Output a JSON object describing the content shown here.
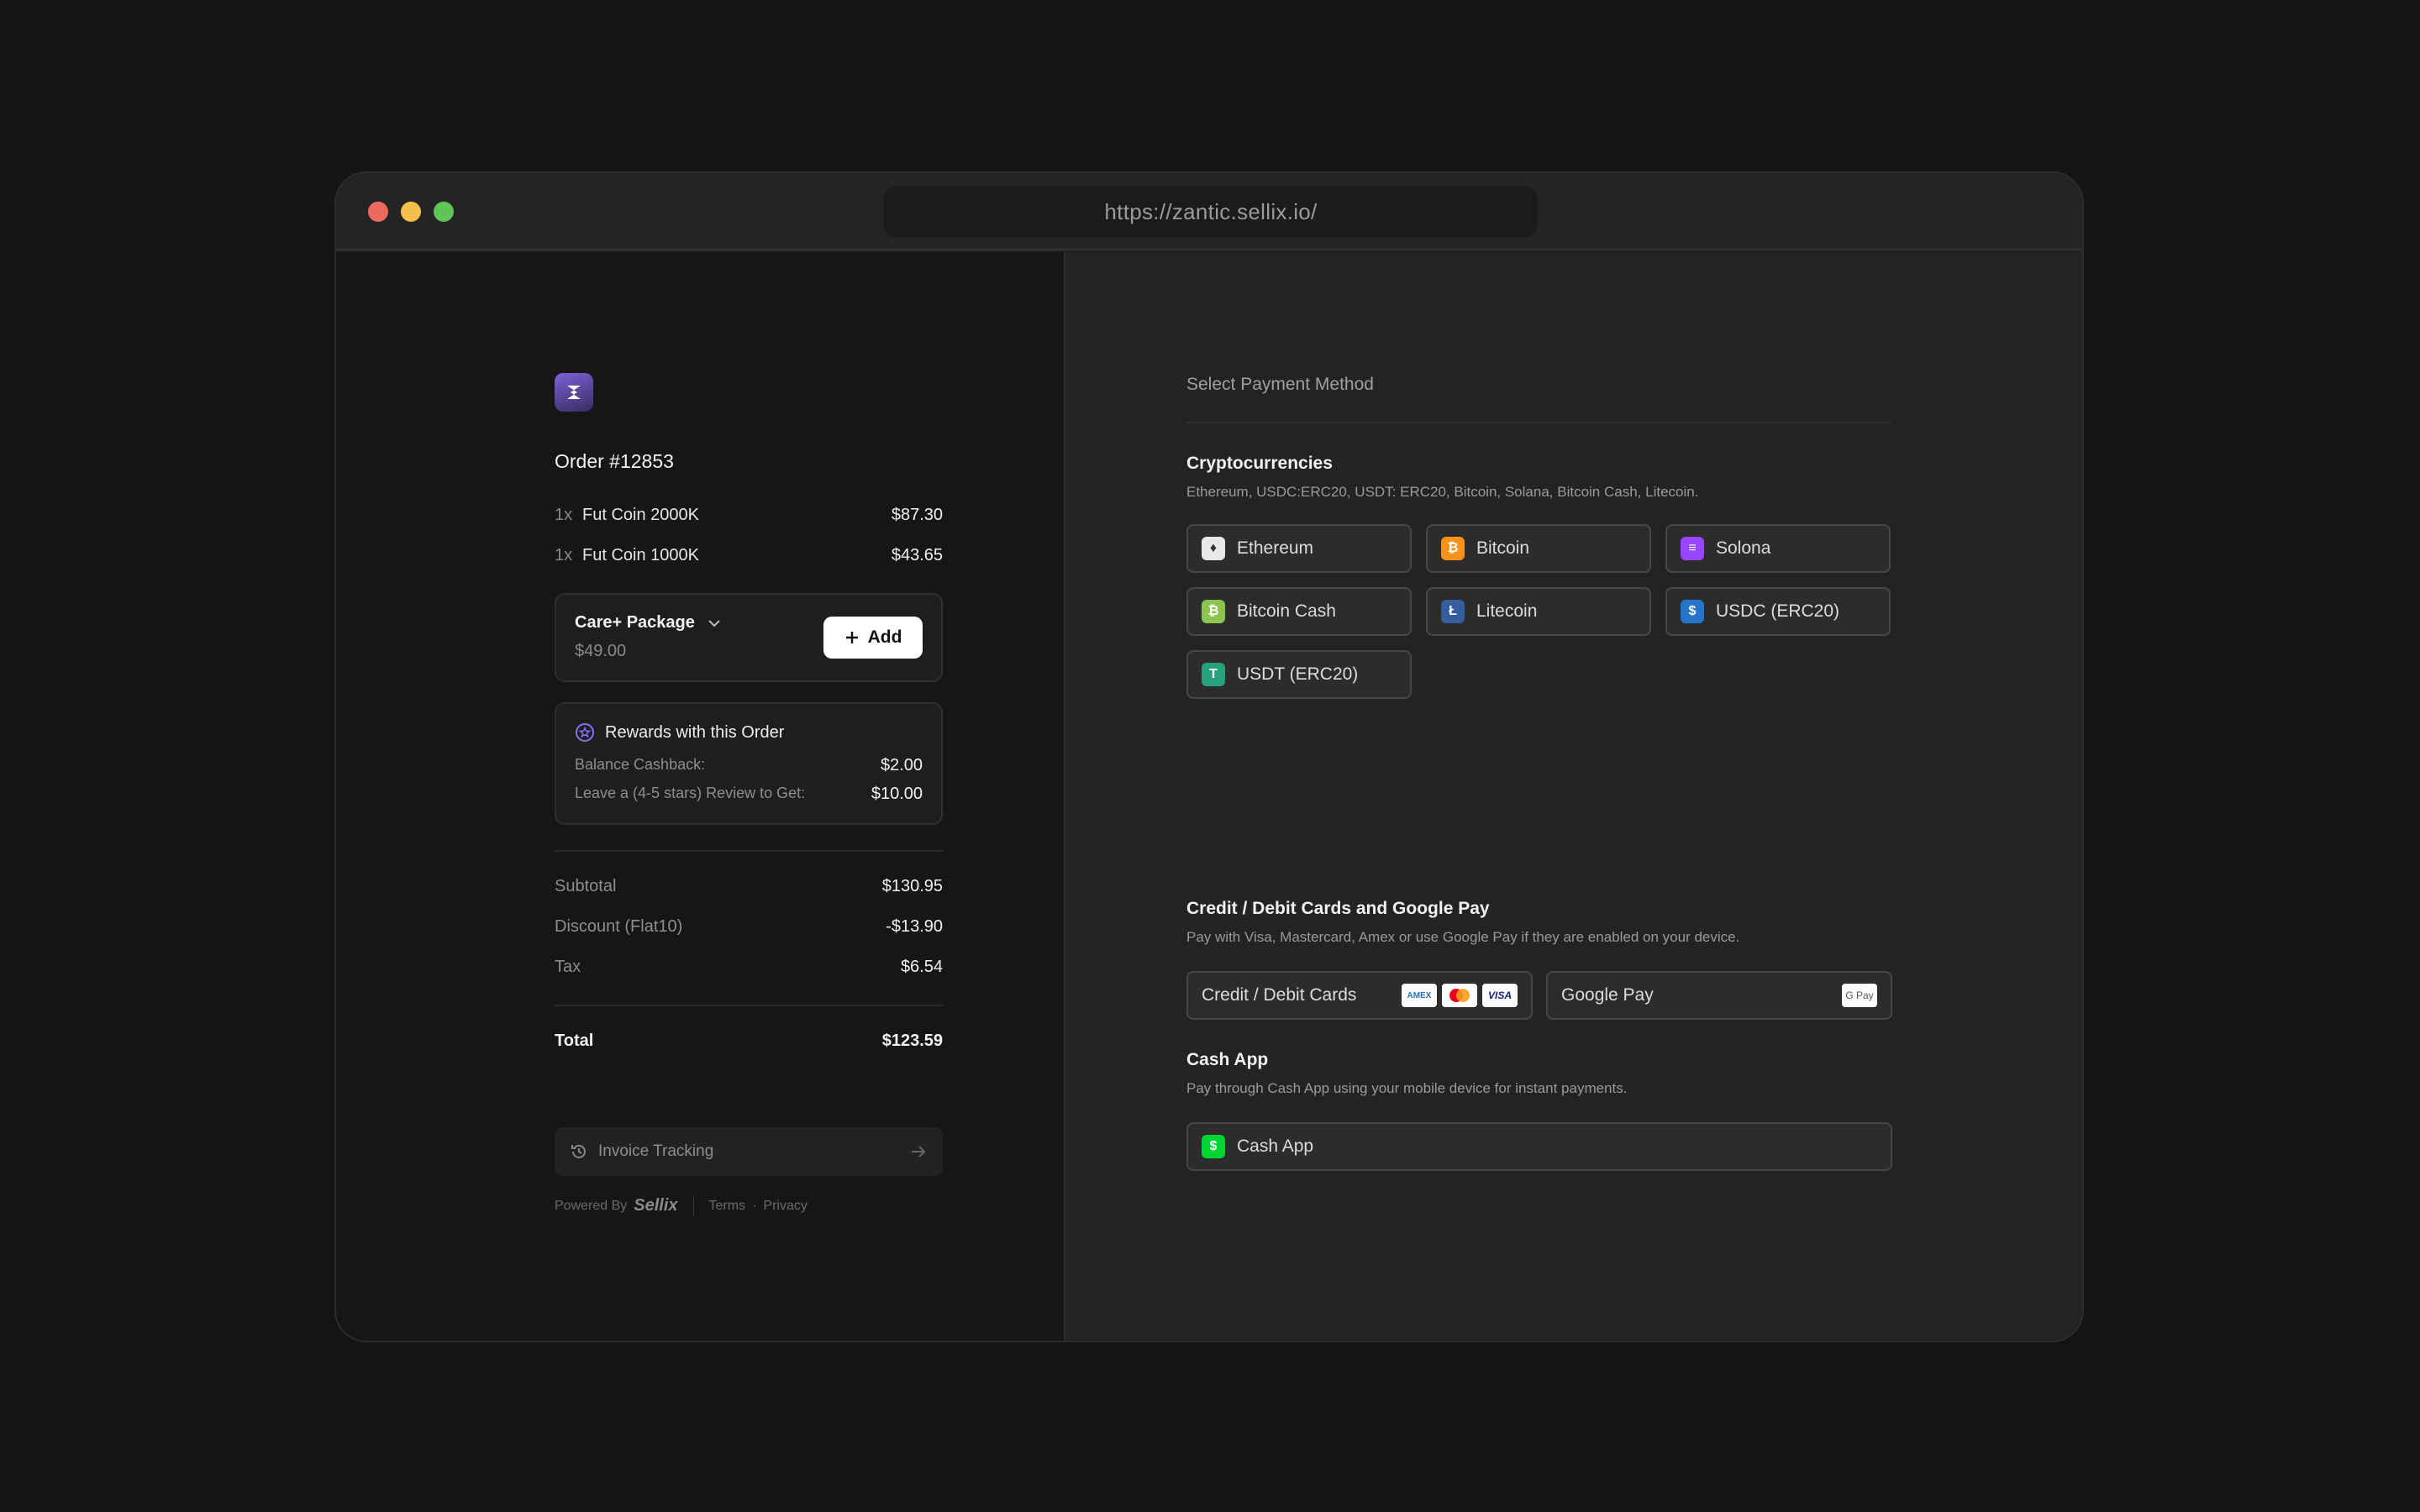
{
  "browser": {
    "url": "https://zantic.sellix.io/"
  },
  "order": {
    "title": "Order #12853",
    "items": [
      {
        "qty": "1x",
        "name": "Fut Coin 2000K",
        "price": "$87.30"
      },
      {
        "qty": "1x",
        "name": "Fut Coin 1000K",
        "price": "$43.65"
      }
    ],
    "upsell": {
      "title": "Care+ Package",
      "price": "$49.00",
      "add_label": "Add"
    },
    "rewards": {
      "title": "Rewards with this Order",
      "rows": [
        {
          "label": "Balance Cashback:",
          "value": "$2.00"
        },
        {
          "label": "Leave a (4-5 stars) Review to Get:",
          "value": "$10.00"
        }
      ]
    },
    "summary": [
      {
        "label": "Subtotal",
        "value": "$130.95"
      },
      {
        "label": "Discount (Flat10)",
        "value": "-$13.90"
      },
      {
        "label": "Tax",
        "value": "$6.54"
      }
    ],
    "total": {
      "label": "Total",
      "value": "$123.59"
    },
    "tracking_label": "Invoice Tracking",
    "footer": {
      "powered_by": "Powered By",
      "brand": "Sellix",
      "terms": "Terms",
      "dot": "·",
      "privacy": "Privacy"
    }
  },
  "payment": {
    "title": "Select Payment Method",
    "crypto": {
      "title": "Cryptocurrencies",
      "desc": "Ethereum, USDC:ERC20, USDT: ERC20, Bitcoin, Solana, Bitcoin Cash, Litecoin.",
      "options": [
        {
          "label": "Ethereum",
          "icon": "ethereum-icon",
          "glyph": "♦",
          "color": "#e8e8e8"
        },
        {
          "label": "Bitcoin",
          "icon": "bitcoin-icon",
          "glyph": "₿",
          "color": "#f7931a"
        },
        {
          "label": "Solona",
          "icon": "solana-icon",
          "glyph": "≡",
          "color": "#9945ff"
        },
        {
          "label": "Bitcoin Cash",
          "icon": "bitcoin-cash-icon",
          "glyph": "₿",
          "color": "#8dc351"
        },
        {
          "label": "Litecoin",
          "icon": "litecoin-icon",
          "glyph": "Ł",
          "color": "#345d9d"
        },
        {
          "label": "USDC (ERC20)",
          "icon": "usdc-icon",
          "glyph": "$",
          "color": "#2775ca"
        },
        {
          "label": "USDT (ERC20)",
          "icon": "usdt-icon",
          "glyph": "T",
          "color": "#26a17b"
        }
      ]
    },
    "cards": {
      "title": "Credit / Debit Cards and Google Pay",
      "desc": "Pay with Visa, Mastercard, Amex or use Google Pay if they are enabled on your device.",
      "card_label": "Credit / Debit Cards",
      "amex": "AMEX",
      "visa": "VISA",
      "gpay_label": "Google Pay",
      "gpay_badge": "G Pay"
    },
    "cashapp": {
      "title": "Cash App",
      "desc": "Pay through Cash App using your mobile device for instant payments.",
      "label": "Cash App",
      "color": "#00d632"
    }
  }
}
